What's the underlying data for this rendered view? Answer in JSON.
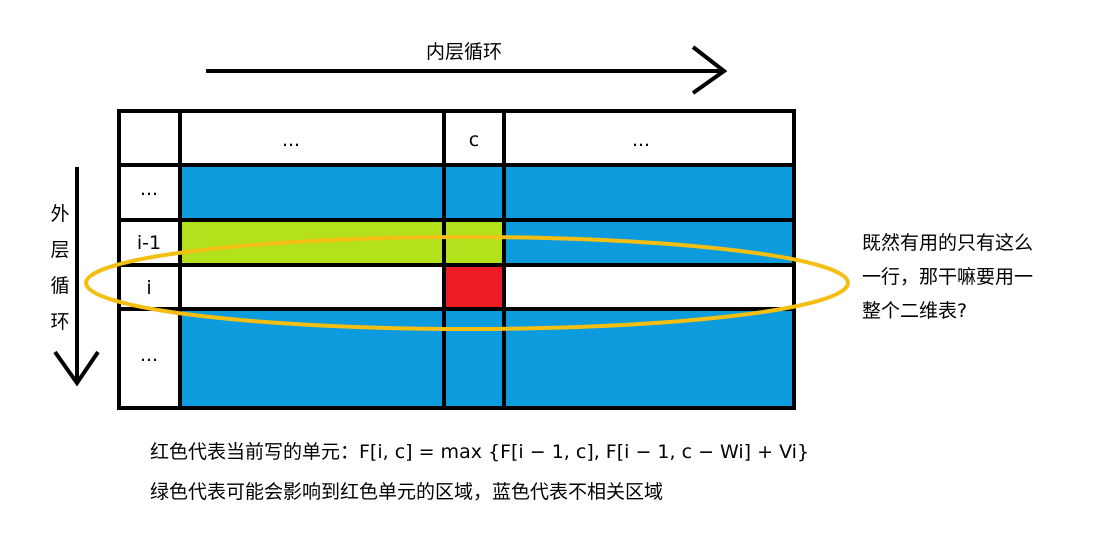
{
  "inner_loop_label": "内层循环",
  "outer_loop_label": [
    "外",
    "层",
    "循",
    "环"
  ],
  "table": {
    "header_cells": [
      "...",
      "c",
      "..."
    ],
    "row_labels": [
      "...",
      "i-1",
      "i",
      "..."
    ]
  },
  "side_note": {
    "lines": [
      "既然有用的只有这么",
      "一行，那干嘛要用一",
      "整个二维表?"
    ]
  },
  "captions": [
    "红色代表当前写的单元：F[i, c] = max {F[i − 1, c], F[i − 1, c − Wi] + Vi}",
    "绿色代表可能会影响到红色单元的区域，蓝色代表不相关区域"
  ],
  "colors": {
    "blue": "#0c9bdd",
    "green": "#b3e21c",
    "red": "#ec1c24",
    "ellipse": "#f4be12",
    "white": "#ffffff",
    "line": "#000000"
  }
}
